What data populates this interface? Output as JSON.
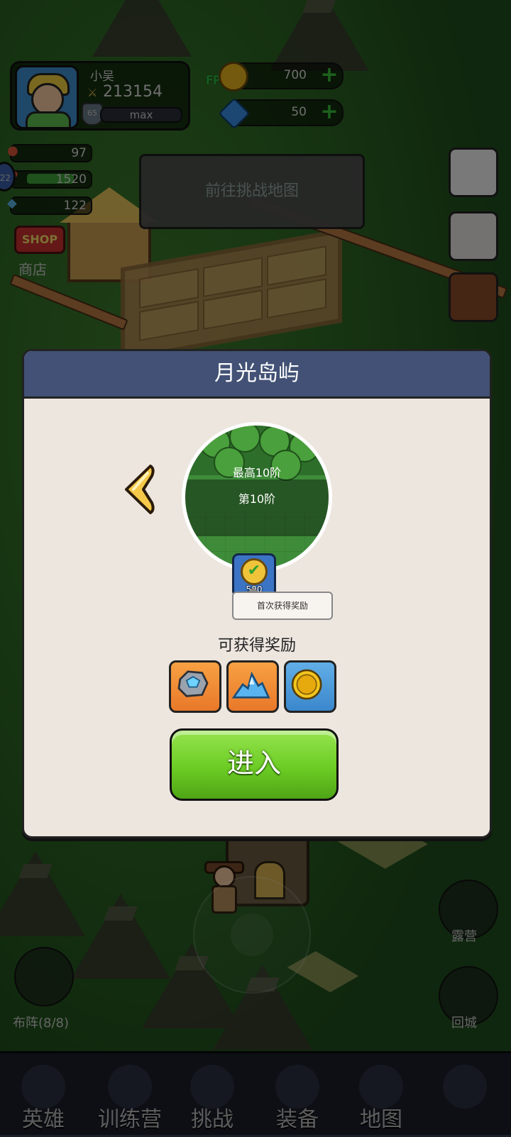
{
  "player": {
    "name": "小吴",
    "power": "213154",
    "level": "65",
    "exp_label": "max"
  },
  "fps": "FPS59",
  "resources": {
    "coins": "700",
    "gems": "50"
  },
  "stats": {
    "stamina": "97",
    "energy": "1520",
    "crystal": "122",
    "side_level": "22"
  },
  "shop": {
    "sign": "SHOP",
    "label": "商店"
  },
  "challenge_button": "前往挑战地图",
  "modal": {
    "title": "月光岛屿",
    "max_stage": "最高10阶",
    "current_stage": "第10阶",
    "first_reward_amount": "500",
    "first_reward_tooltip": "首次获得奖励",
    "rewards_title": "可获得奖励",
    "rewards": [
      "stone-icon",
      "crystal-pile-icon",
      "gold-coin-icon"
    ],
    "enter_label": "进入"
  },
  "side_buttons": {
    "camp": "露营",
    "return_city": "回城",
    "formation": "布阵(8/8)"
  },
  "nav": {
    "items": [
      {
        "label": "英雄",
        "icon": "heroes-icon"
      },
      {
        "label": "训练营",
        "icon": "training-camp-icon"
      },
      {
        "label": "挑战",
        "icon": "challenge-sword-icon"
      },
      {
        "label": "装备",
        "icon": "equipment-icon"
      },
      {
        "label": "地图",
        "icon": "map-scroll-icon"
      },
      {
        "label": "",
        "icon": "locked-icon"
      }
    ]
  },
  "colors": {
    "modal_header": "#425175",
    "modal_body": "#ede6df",
    "enter_button": "#6ccc24",
    "fps_text": "#22d04a"
  }
}
